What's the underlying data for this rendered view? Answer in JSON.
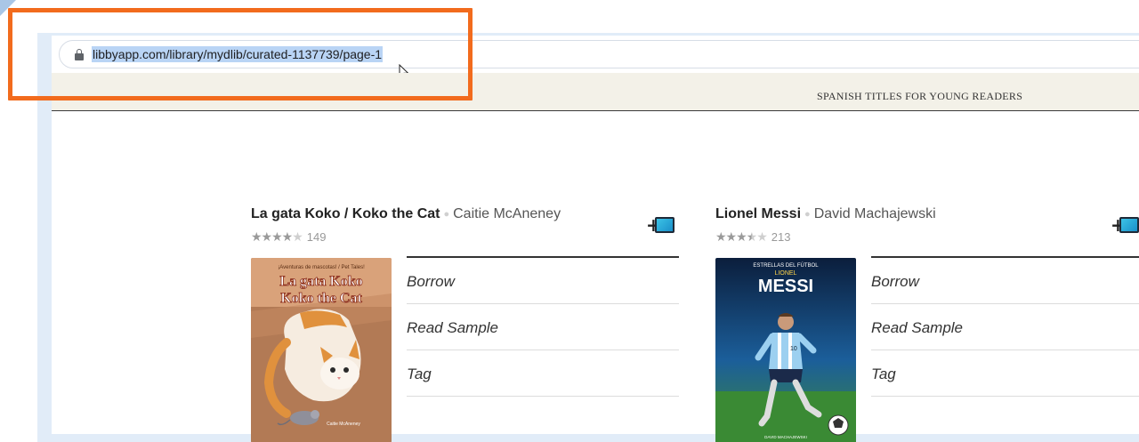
{
  "browser": {
    "url": "libbyapp.com/library/mydlib/curated-1137739/page-1"
  },
  "app": {
    "list_title": "SPANISH TITLES FOR YOUNG READERS"
  },
  "books": [
    {
      "title": "La gata Koko / Koko the Cat",
      "author": "Caitie McAneney",
      "rating": 4.0,
      "rating_count": "149",
      "cover_top_text": "¡Aventuras de mascotas! / Pet Tales!",
      "cover_title": "La gata Koko Koko the Cat",
      "actions": [
        "Borrow",
        "Read Sample",
        "Tag"
      ]
    },
    {
      "title": "Lionel Messi",
      "author": "David Machajewski",
      "rating": 3.5,
      "rating_count": "213",
      "cover_top_text": "ESTRELLAS DEL FÚTBOL",
      "cover_title": "LIONEL MESSI",
      "actions": [
        "Borrow",
        "Read Sample",
        "Tag"
      ]
    }
  ],
  "colors": {
    "highlight": "#f26b1d",
    "url_selection": "#b9d4f5",
    "app_bar": "#f3f1e8",
    "frame": "#e1ecf8"
  }
}
